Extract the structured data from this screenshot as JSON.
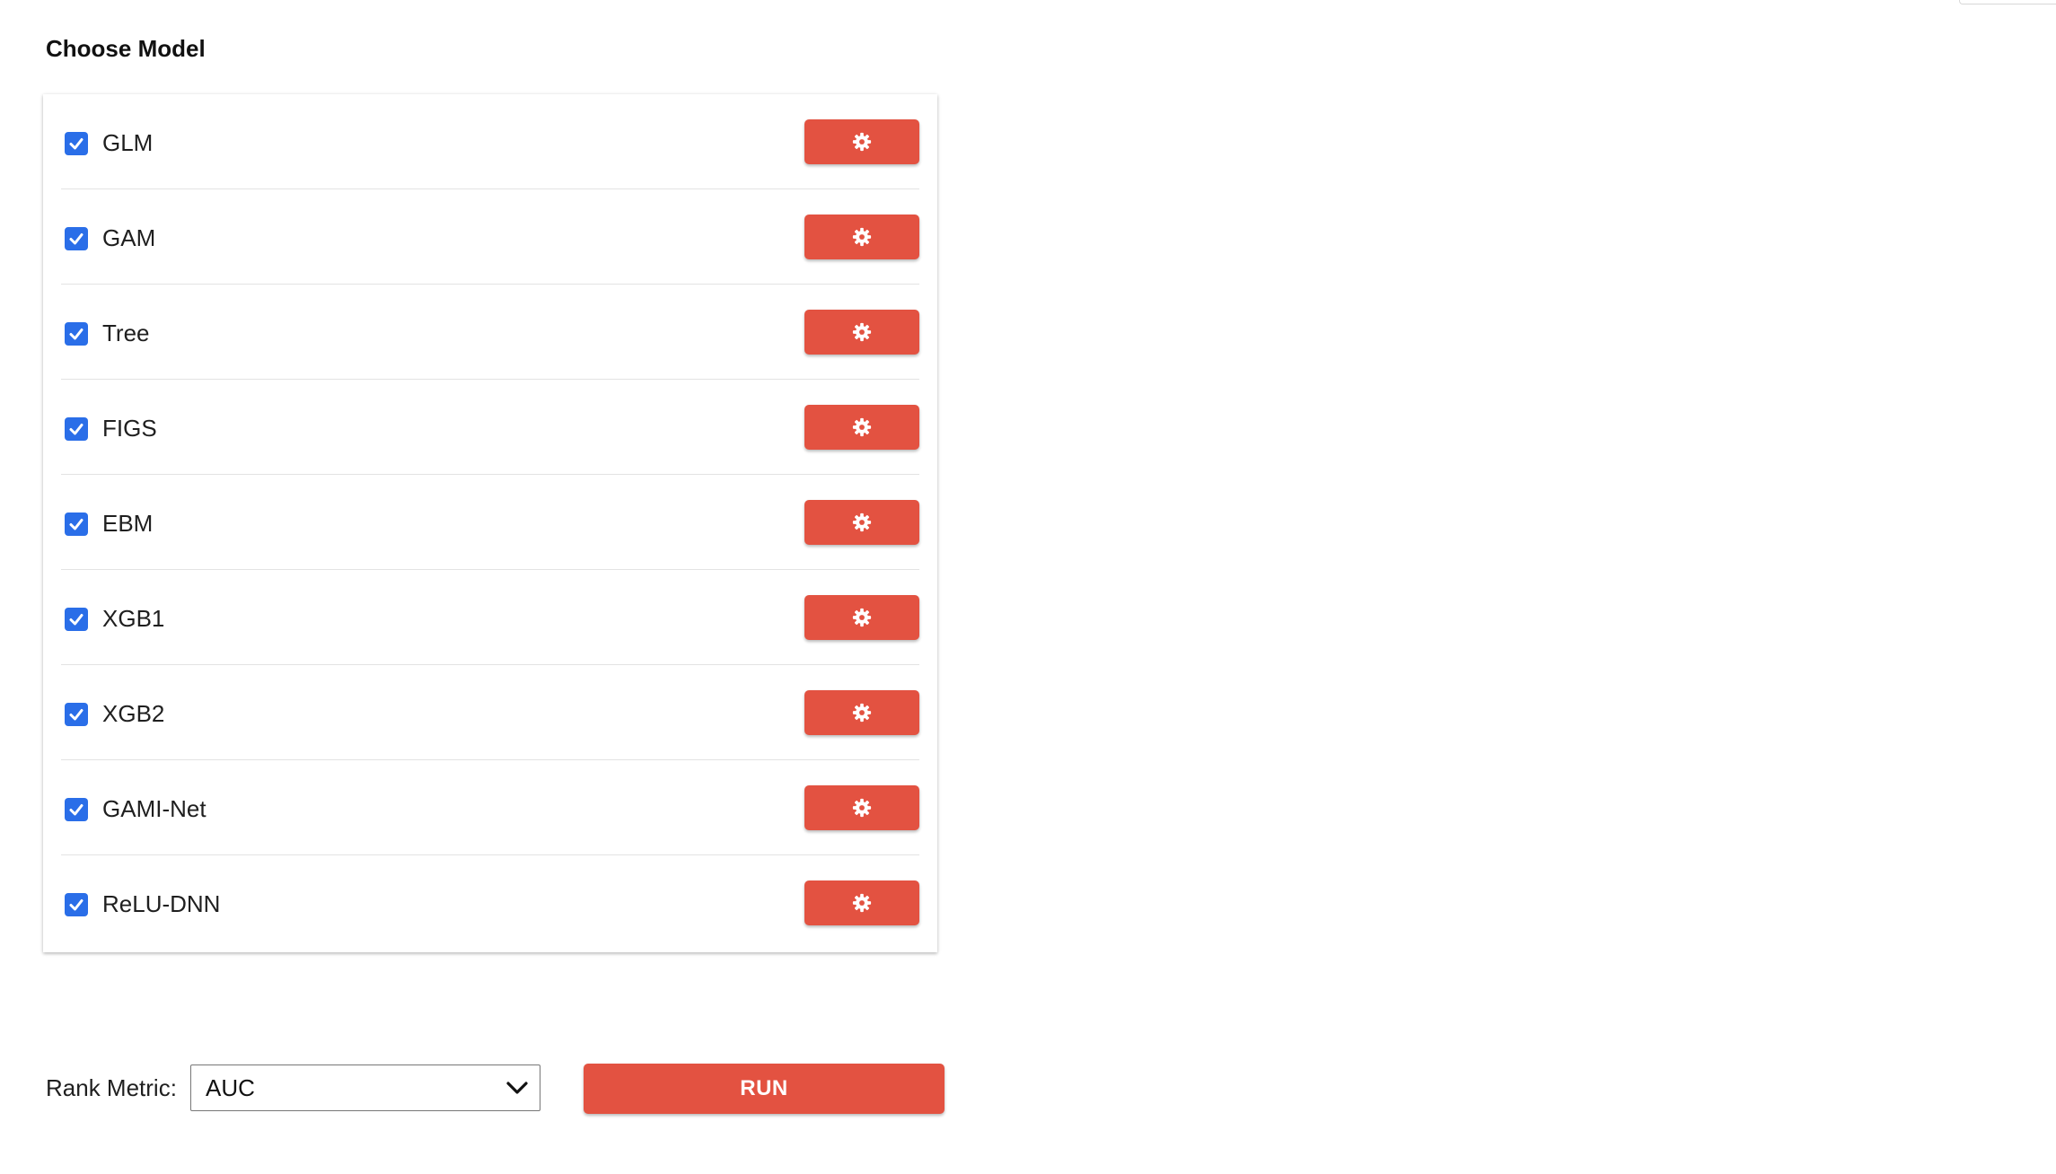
{
  "section_title": "Choose Model",
  "models": [
    {
      "label": "GLM",
      "checked": true
    },
    {
      "label": "GAM",
      "checked": true
    },
    {
      "label": "Tree",
      "checked": true
    },
    {
      "label": "FIGS",
      "checked": true
    },
    {
      "label": "EBM",
      "checked": true
    },
    {
      "label": "XGB1",
      "checked": true
    },
    {
      "label": "XGB2",
      "checked": true
    },
    {
      "label": "GAMI-Net",
      "checked": true
    },
    {
      "label": "ReLU-DNN",
      "checked": true
    }
  ],
  "settings_icon": "gear-icon",
  "rank_metric": {
    "label": "Rank Metric:",
    "selected": "AUC"
  },
  "run_button": {
    "label": "RUN"
  },
  "colors": {
    "accent": "#e35241",
    "checkbox": "#2a6ee8"
  }
}
